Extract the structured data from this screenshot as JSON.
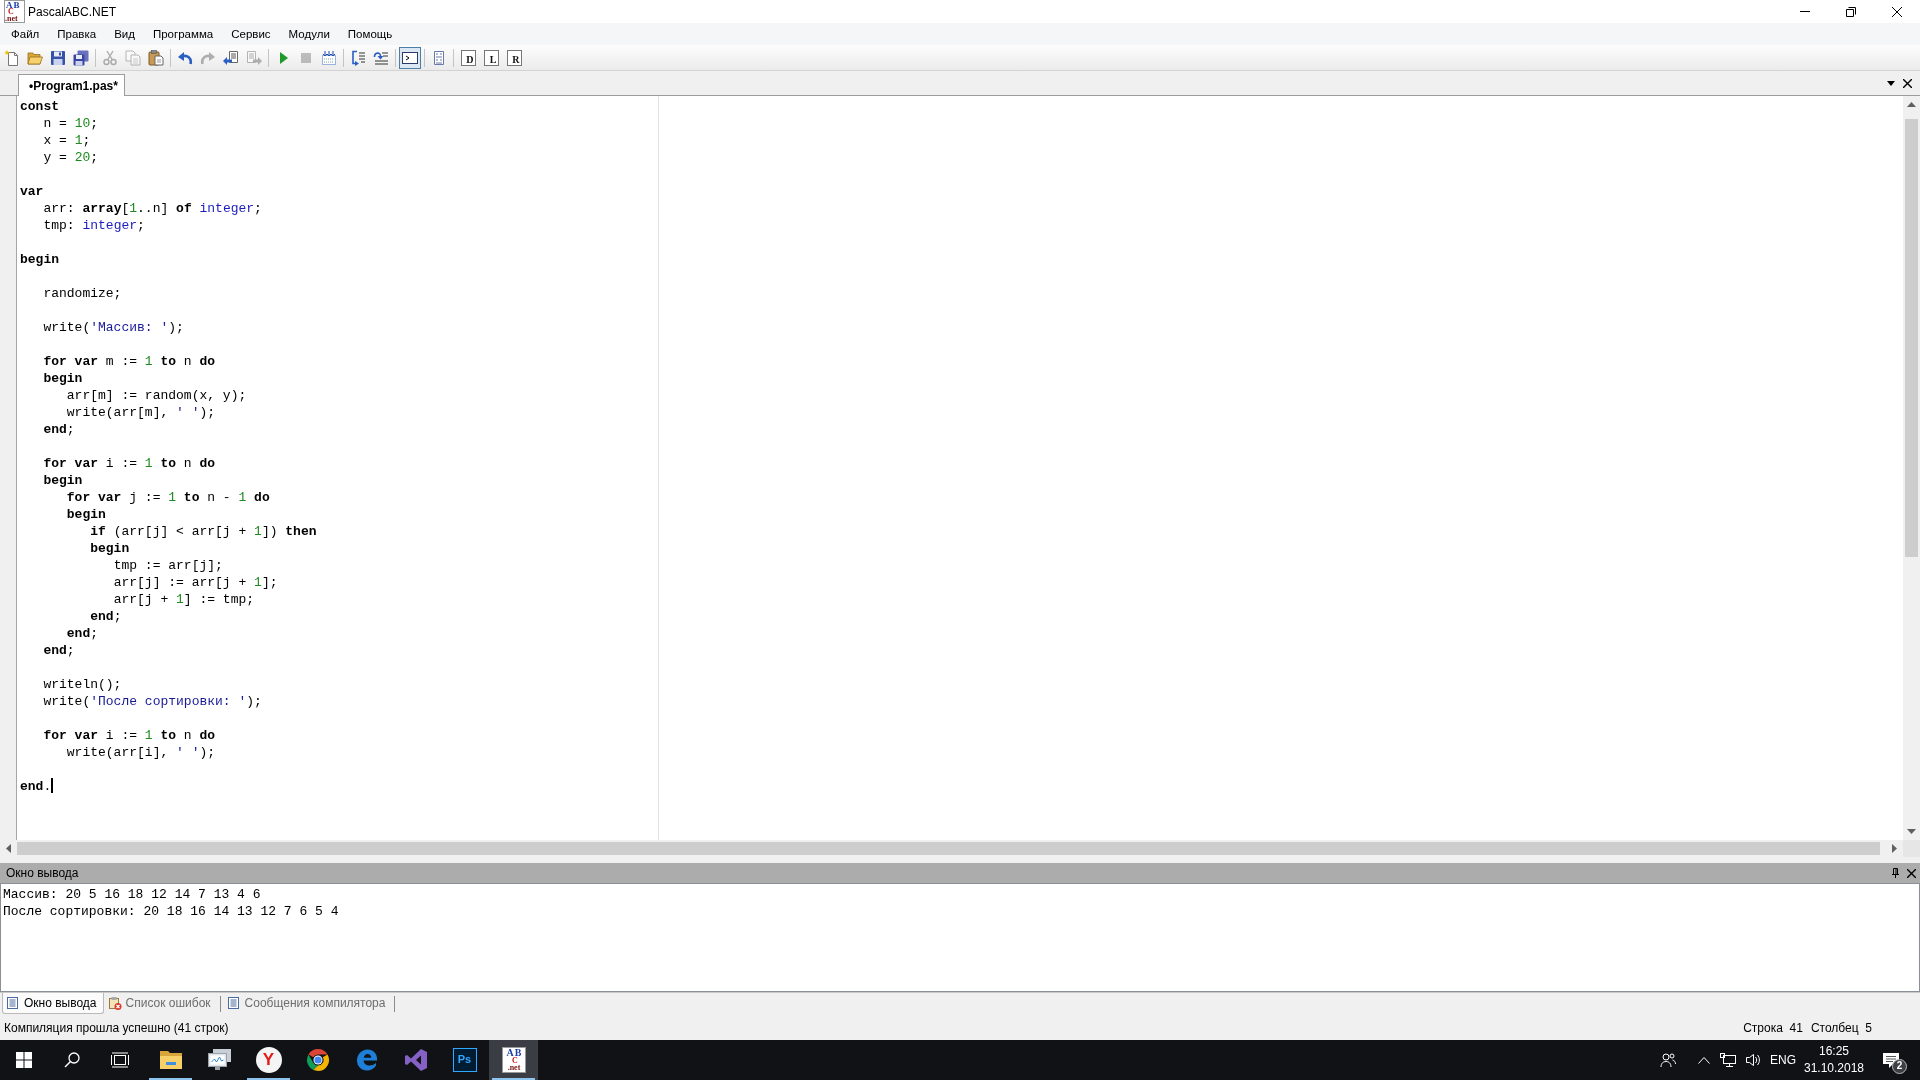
{
  "window": {
    "title": "PascalABC.NET",
    "logo_lines": [
      "AB",
      "C",
      ".net"
    ]
  },
  "menu": [
    "Файл",
    "Правка",
    "Вид",
    "Программа",
    "Сервис",
    "Модули",
    "Помощь"
  ],
  "toolbar": {
    "groups": [
      {
        "buttons": [
          {
            "disabled": false,
            "on": false
          },
          {
            "disabled": false,
            "on": false
          },
          {
            "disabled": false,
            "on": false
          },
          {
            "disabled": false,
            "on": false
          }
        ]
      },
      {
        "buttons": [
          {
            "disabled": true,
            "on": false
          },
          {
            "disabled": true,
            "on": false
          },
          {
            "disabled": false,
            "on": false
          }
        ]
      },
      {
        "buttons": [
          {
            "disabled": false,
            "on": false
          },
          {
            "disabled": true,
            "on": false
          },
          {
            "disabled": false,
            "on": false
          },
          {
            "disabled": true,
            "on": false
          }
        ]
      },
      {
        "buttons": [
          {
            "disabled": false,
            "on": false
          },
          {
            "disabled": true,
            "on": false
          },
          {
            "disabled": false,
            "on": false
          }
        ]
      },
      {
        "buttons": [
          {
            "disabled": false,
            "on": false
          },
          {
            "disabled": false,
            "on": false
          }
        ]
      },
      {
        "buttons": [
          {
            "disabled": false,
            "on": true
          }
        ]
      },
      {
        "buttons": [
          {
            "disabled": false,
            "on": false
          }
        ]
      },
      {
        "buttons": [
          {
            "disabled": false,
            "on": false,
            "glyph": "D"
          },
          {
            "disabled": false,
            "on": false,
            "glyph": "L"
          },
          {
            "disabled": false,
            "on": false,
            "glyph": "R"
          }
        ]
      }
    ]
  },
  "editor_tabs": [
    {
      "label": "•Program1.pas*",
      "selected": true
    }
  ],
  "editor": {
    "lines": [
      {
        "kind": "code",
        "segments": [
          {
            "kind": "keyword",
            "text": "const"
          }
        ]
      },
      {
        "kind": "code",
        "segments": [
          {
            "kind": "plain",
            "text": "   n = "
          },
          {
            "kind": "number",
            "text": "10"
          },
          {
            "kind": "plain",
            "text": ";"
          }
        ]
      },
      {
        "kind": "code",
        "segments": [
          {
            "kind": "plain",
            "text": "   x = "
          },
          {
            "kind": "number",
            "text": "1"
          },
          {
            "kind": "plain",
            "text": ";"
          }
        ]
      },
      {
        "kind": "code",
        "segments": [
          {
            "kind": "plain",
            "text": "   y = "
          },
          {
            "kind": "number",
            "text": "20"
          },
          {
            "kind": "plain",
            "text": ";"
          }
        ]
      },
      {
        "kind": "blank"
      },
      {
        "kind": "code",
        "segments": [
          {
            "kind": "keyword",
            "text": "var"
          }
        ]
      },
      {
        "kind": "code",
        "segments": [
          {
            "kind": "plain",
            "text": "   arr: "
          },
          {
            "kind": "keyword",
            "text": "array"
          },
          {
            "kind": "plain",
            "text": "["
          },
          {
            "kind": "number",
            "text": "1"
          },
          {
            "kind": "plain",
            "text": "..n] "
          },
          {
            "kind": "keyword",
            "text": "of"
          },
          {
            "kind": "type",
            "text": " integer"
          },
          {
            "kind": "plain",
            "text": ";"
          }
        ]
      },
      {
        "kind": "code",
        "segments": [
          {
            "kind": "plain",
            "text": "   tmp: "
          },
          {
            "kind": "type",
            "text": "integer"
          },
          {
            "kind": "plain",
            "text": ";"
          }
        ]
      },
      {
        "kind": "blank"
      },
      {
        "kind": "code",
        "segments": [
          {
            "kind": "keyword",
            "text": "begin"
          }
        ]
      },
      {
        "kind": "blank"
      },
      {
        "kind": "code",
        "segments": [
          {
            "kind": "plain",
            "text": "   randomize;"
          }
        ]
      },
      {
        "kind": "blank"
      },
      {
        "kind": "code",
        "segments": [
          {
            "kind": "plain",
            "text": "   write("
          },
          {
            "kind": "string",
            "text": "'Массив: '"
          },
          {
            "kind": "plain",
            "text": ");"
          }
        ]
      },
      {
        "kind": "blank"
      },
      {
        "kind": "code",
        "segments": [
          {
            "kind": "keyword",
            "text": "   for var"
          },
          {
            "kind": "plain",
            "text": " m := "
          },
          {
            "kind": "number",
            "text": "1"
          },
          {
            "kind": "keyword",
            "text": " to"
          },
          {
            "kind": "plain",
            "text": " n "
          },
          {
            "kind": "keyword",
            "text": "do"
          }
        ]
      },
      {
        "kind": "code",
        "segments": [
          {
            "kind": "keyword",
            "text": "   begin"
          }
        ]
      },
      {
        "kind": "code",
        "segments": [
          {
            "kind": "plain",
            "text": "      arr[m] := random(x, y);"
          }
        ]
      },
      {
        "kind": "code",
        "segments": [
          {
            "kind": "plain",
            "text": "      write(arr[m], "
          },
          {
            "kind": "string",
            "text": "' '"
          },
          {
            "kind": "plain",
            "text": ");"
          }
        ]
      },
      {
        "kind": "code",
        "segments": [
          {
            "kind": "keyword",
            "text": "   end"
          },
          {
            "kind": "plain",
            "text": ";"
          }
        ]
      },
      {
        "kind": "blank"
      },
      {
        "kind": "code",
        "segments": [
          {
            "kind": "keyword",
            "text": "   for var"
          },
          {
            "kind": "plain",
            "text": " i := "
          },
          {
            "kind": "number",
            "text": "1"
          },
          {
            "kind": "keyword",
            "text": " to"
          },
          {
            "kind": "plain",
            "text": " n "
          },
          {
            "kind": "keyword",
            "text": "do"
          }
        ]
      },
      {
        "kind": "code",
        "segments": [
          {
            "kind": "keyword",
            "text": "   begin"
          }
        ]
      },
      {
        "kind": "code",
        "segments": [
          {
            "kind": "keyword",
            "text": "      for var"
          },
          {
            "kind": "plain",
            "text": " j := "
          },
          {
            "kind": "number",
            "text": "1"
          },
          {
            "kind": "keyword",
            "text": " to"
          },
          {
            "kind": "plain",
            "text": " n - "
          },
          {
            "kind": "number",
            "text": "1"
          },
          {
            "kind": "keyword",
            "text": " do"
          }
        ]
      },
      {
        "kind": "code",
        "segments": [
          {
            "kind": "keyword",
            "text": "      begin"
          }
        ]
      },
      {
        "kind": "code",
        "segments": [
          {
            "kind": "keyword",
            "text": "         if"
          },
          {
            "kind": "plain",
            "text": " (arr[j] < arr[j + "
          },
          {
            "kind": "number",
            "text": "1"
          },
          {
            "kind": "plain",
            "text": "]) "
          },
          {
            "kind": "keyword",
            "text": "then"
          }
        ]
      },
      {
        "kind": "code",
        "segments": [
          {
            "kind": "keyword",
            "text": "         begin"
          }
        ]
      },
      {
        "kind": "code",
        "segments": [
          {
            "kind": "plain",
            "text": "            tmp := arr[j];"
          }
        ]
      },
      {
        "kind": "code",
        "segments": [
          {
            "kind": "plain",
            "text": "            arr[j] := arr[j + "
          },
          {
            "kind": "number",
            "text": "1"
          },
          {
            "kind": "plain",
            "text": "];"
          }
        ]
      },
      {
        "kind": "code",
        "segments": [
          {
            "kind": "plain",
            "text": "            arr[j + "
          },
          {
            "kind": "number",
            "text": "1"
          },
          {
            "kind": "plain",
            "text": "] := tmp;"
          }
        ]
      },
      {
        "kind": "code",
        "segments": [
          {
            "kind": "keyword",
            "text": "         end"
          },
          {
            "kind": "plain",
            "text": ";"
          }
        ]
      },
      {
        "kind": "code",
        "segments": [
          {
            "kind": "keyword",
            "text": "      end"
          },
          {
            "kind": "plain",
            "text": ";"
          }
        ]
      },
      {
        "kind": "code",
        "segments": [
          {
            "kind": "keyword",
            "text": "   end"
          },
          {
            "kind": "plain",
            "text": ";"
          }
        ]
      },
      {
        "kind": "blank"
      },
      {
        "kind": "code",
        "segments": [
          {
            "kind": "plain",
            "text": "   writeln();"
          }
        ]
      },
      {
        "kind": "code",
        "segments": [
          {
            "kind": "plain",
            "text": "   write("
          },
          {
            "kind": "string",
            "text": "'После сортировки: '"
          },
          {
            "kind": "plain",
            "text": ");"
          }
        ]
      },
      {
        "kind": "blank"
      },
      {
        "kind": "code",
        "segments": [
          {
            "kind": "keyword",
            "text": "   for var"
          },
          {
            "kind": "plain",
            "text": " i := "
          },
          {
            "kind": "number",
            "text": "1"
          },
          {
            "kind": "keyword",
            "text": " to"
          },
          {
            "kind": "plain",
            "text": " n "
          },
          {
            "kind": "keyword",
            "text": "do"
          }
        ]
      },
      {
        "kind": "code",
        "segments": [
          {
            "kind": "plain",
            "text": "      write(arr[i], "
          },
          {
            "kind": "string",
            "text": "' '"
          },
          {
            "kind": "plain",
            "text": ");"
          }
        ]
      },
      {
        "kind": "blank"
      },
      {
        "kind": "code",
        "caret": true,
        "segments": [
          {
            "kind": "keyword",
            "text": "end"
          },
          {
            "kind": "plain",
            "text": "."
          }
        ]
      }
    ]
  },
  "output": {
    "title": "Окно вывода",
    "lines": [
      "Массив: 20 5 16 18 12 14 7 13 4 6",
      "После сортировки: 20 18 16 14 13 12 7 6 5 4"
    ]
  },
  "bottom_tabs": [
    {
      "label": "Окно вывода",
      "selected": true
    },
    {
      "label": "Список ошибок",
      "selected": false
    },
    {
      "label": "Сообщения компилятора",
      "selected": false
    }
  ],
  "status_bar": {
    "message": "Компиляция прошла успешно (41 строк)",
    "line": "Строка  41",
    "column": "Столбец  5"
  },
  "taskbar": {
    "apps": [
      {
        "running": true,
        "active": false
      },
      {
        "running": false,
        "active": false
      },
      {
        "running": true,
        "active": false,
        "glyph": "Y"
      },
      {
        "running": false,
        "active": false
      },
      {
        "running": false,
        "active": false
      },
      {
        "running": false,
        "active": false
      },
      {
        "running": false,
        "active": false,
        "glyph": "Ps"
      },
      {
        "running": true,
        "active": true,
        "logo_lines": [
          "AB",
          "C",
          ".net"
        ]
      }
    ],
    "language": "ENG",
    "time": "16:25",
    "date": "31.10.2018",
    "notifications": "2"
  }
}
